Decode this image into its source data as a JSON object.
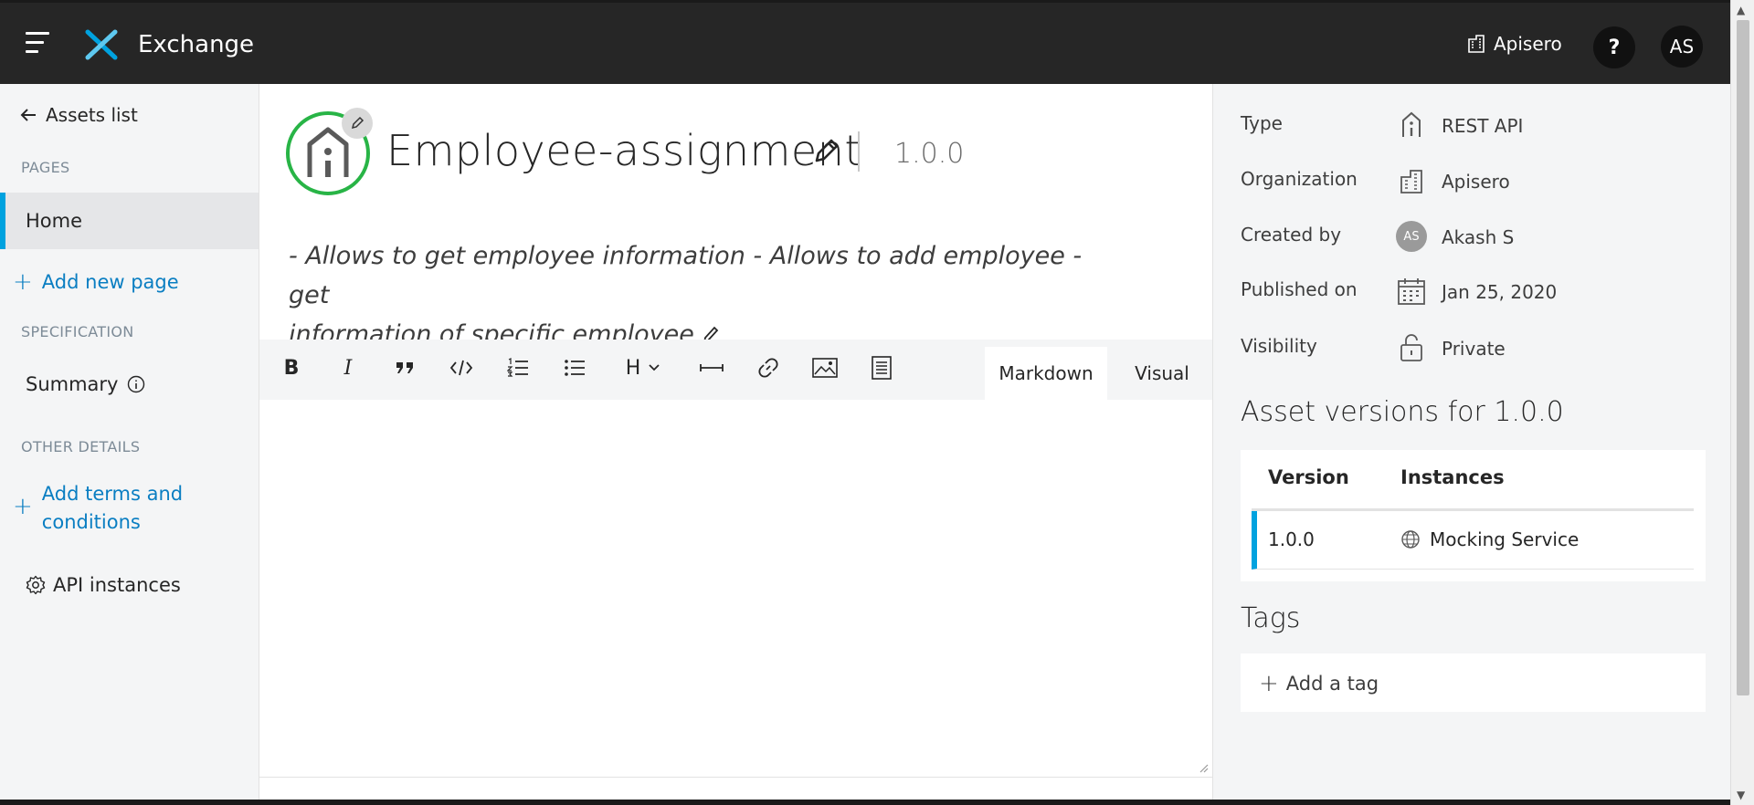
{
  "header": {
    "app_title": "Exchange",
    "org_name": "Apisero",
    "help_label": "?",
    "user_initials": "AS"
  },
  "sidebar": {
    "back_label": "Assets list",
    "pages_heading": "PAGES",
    "home_label": "Home",
    "add_page_label": "Add new page",
    "spec_heading": "SPECIFICATION",
    "summary_label": "Summary",
    "other_heading": "OTHER DETAILS",
    "add_terms_line1": "Add terms and",
    "add_terms_line2": "conditions",
    "api_instances_label": "API instances"
  },
  "asset": {
    "title": "Employee-assignment",
    "version": "1.0.0",
    "description_line1": "- Allows to get employee information - Allows to add employee - get",
    "description_line2": "information of specific employee"
  },
  "editor": {
    "toolbar": {
      "bold": "B",
      "italic": "I",
      "heading": "H"
    },
    "tabs": {
      "markdown": "Markdown",
      "visual": "Visual"
    }
  },
  "details": {
    "type_label": "Type",
    "type_value": "REST API",
    "org_label": "Organization",
    "org_value": "Apisero",
    "created_label": "Created by",
    "created_initials": "AS",
    "created_value": "Akash S",
    "published_label": "Published on",
    "published_value": "Jan 25, 2020",
    "visibility_label": "Visibility",
    "visibility_value": "Private"
  },
  "versions": {
    "title": "Asset versions for 1.0.0",
    "col_version": "Version",
    "col_instances": "Instances",
    "rows": [
      {
        "version": "1.0.0",
        "instance": "Mocking Service"
      }
    ]
  },
  "tags": {
    "title": "Tags",
    "add_label": "Add a tag"
  },
  "colors": {
    "topbar": "#262626",
    "accent": "#00a2df",
    "link": "#0a7ec2",
    "asset_ring": "#28b446"
  }
}
